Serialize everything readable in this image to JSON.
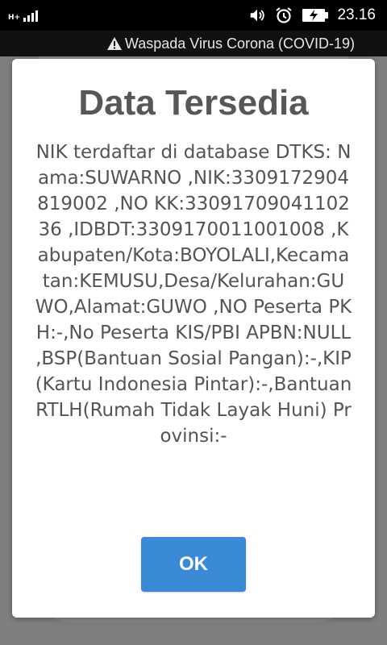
{
  "status_bar": {
    "network_type": "H+",
    "signal_bars": 4,
    "time": "23.16",
    "icons": [
      "volume-icon",
      "alarm-icon",
      "battery-charging-icon"
    ]
  },
  "banner": {
    "warning_icon": "warning-triangle-icon",
    "text": "Waspada Virus Corona (COVID-19)"
  },
  "dialog": {
    "title": "Data Tersedia",
    "message": "NIK terdaftar di database DTKS: Nama:SUWARNO ,NIK:3309172904819002 ,NO KK:3309170904110236 ,IDBDT:3309170011001008 ,Kabupaten/Kota:BOYOLALI,Kecamatan:KEMUSU,Desa/Kelurahan:GUWO,Alamat:GUWO ,NO Peserta PKH:-,No Peserta KIS/PBI APBN:NULL ,BSP(Bantuan Sosial Pangan):-,KIP(Kartu Indonesia Pintar):-,Bantuan RTLH(Rumah Tidak Layak Huni) Provinsi:-",
    "ok_label": "OK"
  },
  "colors": {
    "ok_button": "#3a8ad8",
    "title_text": "#575757",
    "body_text": "#545454"
  }
}
